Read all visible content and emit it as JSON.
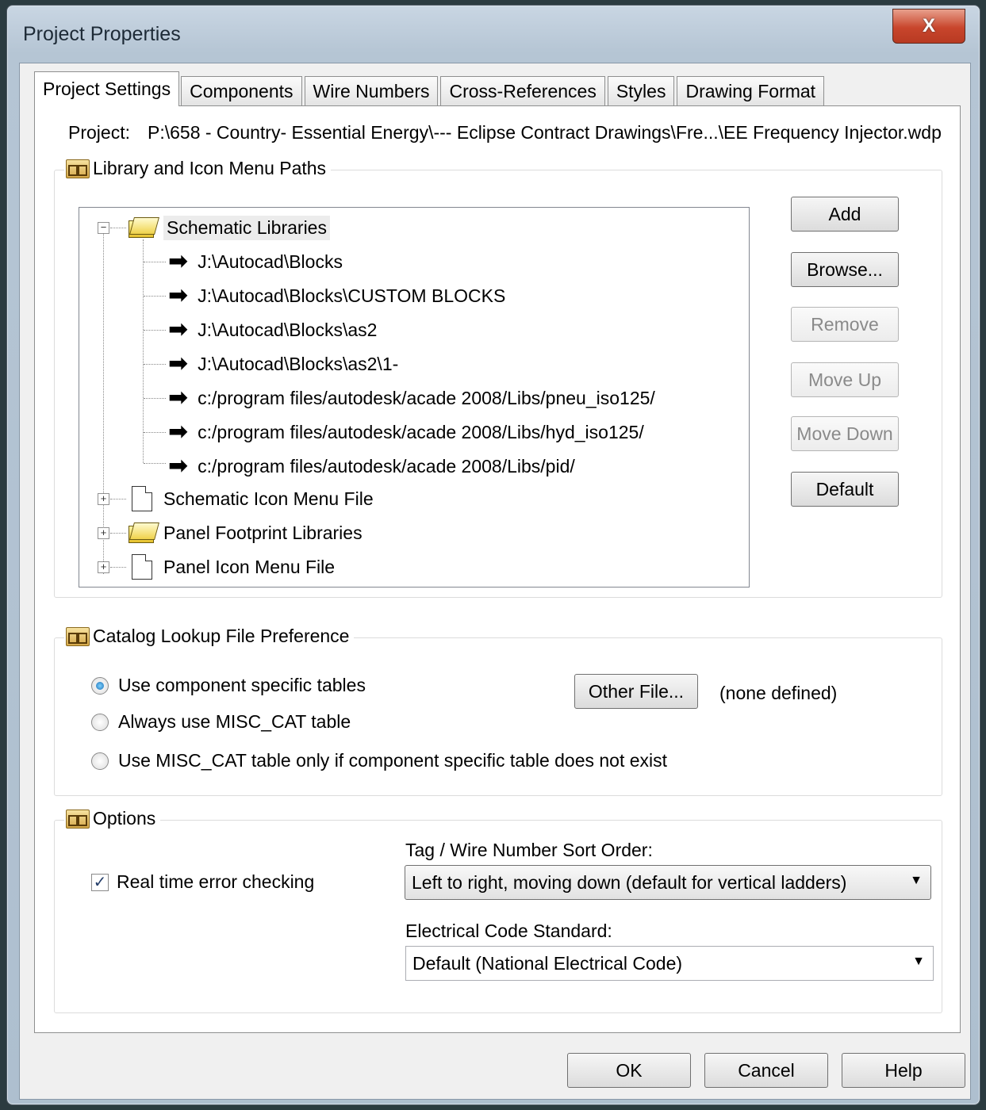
{
  "window": {
    "title": "Project Properties",
    "close_label": "X"
  },
  "tabs": [
    {
      "label": "Project Settings"
    },
    {
      "label": "Components"
    },
    {
      "label": "Wire Numbers"
    },
    {
      "label": "Cross-References"
    },
    {
      "label": "Styles"
    },
    {
      "label": "Drawing Format"
    }
  ],
  "project": {
    "label": "Project:",
    "path": "P:\\658 - Country- Essential Energy\\--- Eclipse Contract Drawings\\Fre...\\EE Frequency Injector.wdp"
  },
  "library_group": {
    "title": "Library and Icon Menu Paths",
    "tree": {
      "schematic_libraries": "Schematic Libraries",
      "paths": [
        "J:\\Autocad\\Blocks",
        "J:\\Autocad\\Blocks\\CUSTOM BLOCKS",
        "J:\\Autocad\\Blocks\\as2",
        "J:\\Autocad\\Blocks\\as2\\1-",
        "c:/program files/autodesk/acade 2008/Libs/pneu_iso125/",
        "c:/program files/autodesk/acade 2008/Libs/hyd_iso125/",
        "c:/program files/autodesk/acade 2008/Libs/pid/"
      ],
      "schematic_icon_menu": "Schematic Icon Menu File",
      "panel_footprint": "Panel Footprint Libraries",
      "panel_icon_menu": "Panel Icon Menu File",
      "expand_glyph": "+",
      "collapse_glyph": "−",
      "arrow_glyph": "➡"
    },
    "buttons": {
      "add": "Add",
      "browse": "Browse...",
      "remove": "Remove",
      "move_up": "Move Up",
      "move_down": "Move Down",
      "default": "Default"
    }
  },
  "catalog_group": {
    "title": "Catalog Lookup File Preference",
    "options": [
      "Use component specific tables",
      "Always use MISC_CAT table",
      "Use MISC_CAT table only if component specific table does not exist"
    ],
    "selected_index": 0,
    "other_file_label": "Other File...",
    "none_defined": "(none defined)"
  },
  "options_group": {
    "title": "Options",
    "realtime_label": "Real time error checking",
    "realtime_checked": true,
    "check_glyph": "✓",
    "sort_label": "Tag / Wire Number Sort Order:",
    "sort_value": "Left to right, moving down (default for vertical ladders)",
    "code_label": "Electrical Code Standard:",
    "code_value": "Default (National Electrical Code)",
    "caret_glyph": "▼"
  },
  "footer": {
    "ok": "OK",
    "cancel": "Cancel",
    "help": "Help"
  }
}
